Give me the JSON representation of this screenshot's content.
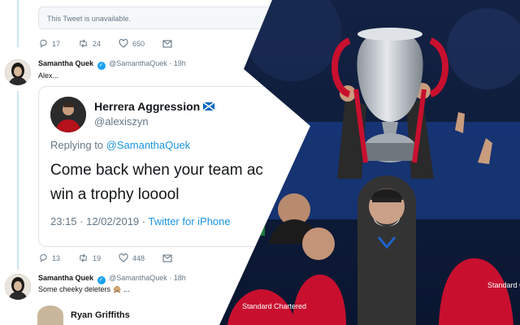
{
  "unavailable_notice": "This Tweet is unavailable.",
  "first_actions": {
    "replies": "17",
    "retweets": "24",
    "likes": "650"
  },
  "tweet1": {
    "display_name": "Samantha Quek",
    "handle": "@SamanthaQuek",
    "time": "· 19h",
    "text": "Alex..."
  },
  "quoted": {
    "display_name": "Herrera Aggression",
    "handle": "@alexiszyn",
    "replying_prefix": "Replying to ",
    "replying_to": "@SamanthaQuek",
    "body_line1": "Come back when your team ac",
    "body_line2": "win a trophy looool",
    "timestamp": "23:15 · 12/02/2019 · ",
    "source": "Twitter for iPhone"
  },
  "second_actions": {
    "replies": "13",
    "retweets": "19",
    "likes": "448"
  },
  "tweet2": {
    "display_name": "Samantha Quek",
    "handle": "@SamanthaQuek",
    "time": "· 18h",
    "text": "Some cheeky deleters 🙊 ..."
  },
  "tweet3": {
    "display_name": "Ryan Griffiths"
  },
  "photo": {
    "shirt_text": "Standard Chartered",
    "colors": {
      "navy": "#0f2346",
      "liverpool_red": "#c8102e",
      "silver": "#c9ced4",
      "twitter_blue": "#1da1f2"
    }
  }
}
